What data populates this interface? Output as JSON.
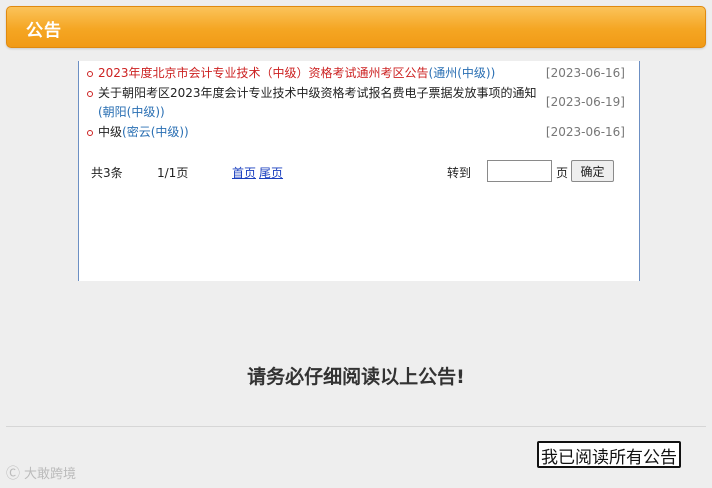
{
  "header": {
    "title": "公告"
  },
  "notices": [
    {
      "title": "2023年度北京市会计专业技术（中级）资格考试通州考区公告",
      "tag": "(通州(中级))",
      "date": "[2023-06-16]"
    },
    {
      "title_line1": "关于朝阳考区2023年度会计专业技术中级资格考试报名费电子票据发放事项的通知",
      "tag": "(朝阳(中级))",
      "date": "[2023-06-19]"
    },
    {
      "title": "中级",
      "tag": "(密云(中级))",
      "date": "[2023-06-16]"
    }
  ],
  "pager": {
    "total": "共3条",
    "page": "1/1页",
    "first": "首页",
    "last": "尾页",
    "goto_label": "转到",
    "page_unit": "页",
    "goto_value": "",
    "ok_label": "确定"
  },
  "main": {
    "notice_text": "请务必仔细阅读以上公告!",
    "read_button": "我已阅读所有公告"
  },
  "watermark": {
    "logo": "Ⓒ",
    "text": "大敢跨境"
  },
  "colors": {
    "header": "#f5a623",
    "red_text": "#cc2222",
    "link": "#2a6fb3",
    "pager_link": "#1a3fbf"
  }
}
